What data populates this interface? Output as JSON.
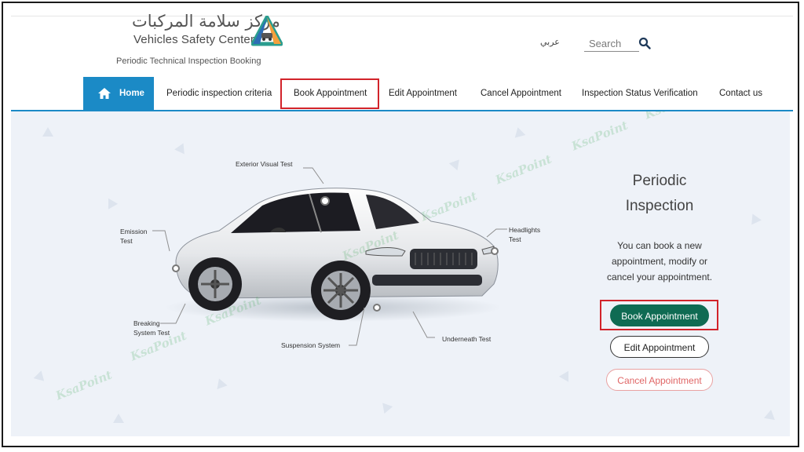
{
  "header": {
    "logo_arabic": "مركز سلامة المركبات",
    "logo_english": "Vehicles Safety Center",
    "tagline": "Periodic Technical Inspection Booking",
    "language_link": "عربي",
    "search_placeholder": "Search"
  },
  "nav": {
    "items": [
      {
        "label": "Home"
      },
      {
        "label": "Periodic inspection criteria"
      },
      {
        "label": "Book Appointment"
      },
      {
        "label": "Edit Appointment"
      },
      {
        "label": "Cancel Appointment"
      },
      {
        "label": "Inspection Status Verification"
      },
      {
        "label": "Contact us"
      }
    ],
    "active": "Home",
    "highlighted": "Book Appointment"
  },
  "diagram": {
    "labels": {
      "exterior": "Exterior Visual Test",
      "emission": "Emission\nTest",
      "headlights": "Headlights\nTest",
      "braking": "Breaking\nSystem Test",
      "suspension": "Suspension System",
      "underneath": "Underneath Test"
    }
  },
  "panel": {
    "title": "Periodic Inspection",
    "description": "You can book a new appointment, modify or cancel your appointment.",
    "book_label": "Book Appointment",
    "edit_label": "Edit Appointment",
    "cancel_label": "Cancel Appointment"
  },
  "watermark": "KsaPoint",
  "colors": {
    "primary_blue": "#1b8ac6",
    "book_green": "#0f6b53",
    "cancel_red": "#e06666",
    "highlight_red": "#d2232a",
    "hero_bg": "#eef2f8"
  }
}
